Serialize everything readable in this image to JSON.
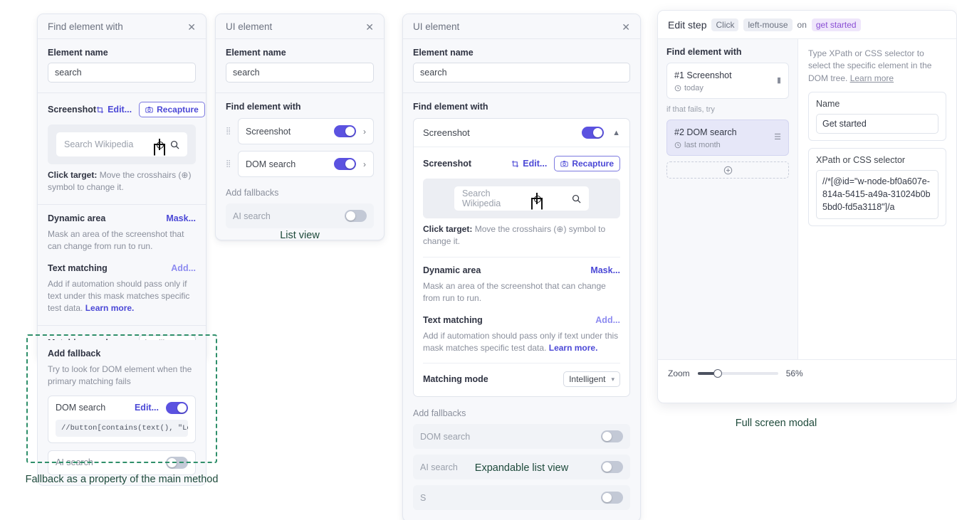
{
  "panel1": {
    "title": "Find element with",
    "close_icon": "close-icon",
    "element_name_label": "Element name",
    "element_name_value": "search",
    "screenshot_label": "Screenshot",
    "edit_label": "Edit...",
    "recapture_label": "Recapture",
    "preview_placeholder": "Search Wikipedia",
    "click_target_bold": "Click target:",
    "click_target_rest": " Move the crosshairs (⊕) symbol to change it.",
    "dynamic_area_label": "Dynamic area",
    "mask_label": "Mask...",
    "dynamic_area_help": "Mask an area of the screenshot that can change from run to run.",
    "text_matching_label": "Text matching",
    "add_label": "Add...",
    "text_matching_help": "Add if automation should pass only if text under this mask matches specific test data. ",
    "learn_more": "Learn more.",
    "matching_mode_label": "Matching mode",
    "matching_mode_value": "Intelligent",
    "fallback_title": "Add fallback",
    "fallback_help": "Try to look for DOM element when the primary matching fails",
    "dom_search_label": "DOM search",
    "dom_edit_label": "Edit...",
    "dom_search_on": true,
    "xpath_code": "//button[contains(text(), \"Login\")]",
    "ai_search_label": "AI search",
    "ai_search_on": false,
    "caption": "Fallback as a property of the main method"
  },
  "panel2": {
    "title": "UI element",
    "element_name_label": "Element name",
    "element_name_value": "search",
    "find_with_label": "Find element with",
    "methods": [
      {
        "label": "Screenshot",
        "on": true
      },
      {
        "label": "DOM search",
        "on": true
      }
    ],
    "add_fallbacks_label": "Add fallbacks",
    "fallbacks": [
      {
        "label": "AI search",
        "on": false
      }
    ],
    "caption": "List view"
  },
  "panel3": {
    "title": "UI element",
    "element_name_label": "Element name",
    "element_name_value": "search",
    "find_with_label": "Find element with",
    "expanded_method": "Screenshot",
    "expanded_on": true,
    "screenshot_label": "Screenshot",
    "edit_label": "Edit...",
    "recapture_label": "Recapture",
    "preview_placeholder": "Search Wikipedia",
    "click_target_bold": "Click target:",
    "click_target_rest": " Move the crosshairs (⊕) symbol to change it.",
    "dynamic_area_label": "Dynamic area",
    "mask_label": "Mask...",
    "dynamic_area_help": "Mask an area of the screenshot that can change from run to run.",
    "text_matching_label": "Text matching",
    "add_label": "Add...",
    "text_matching_help": "Add if automation should pass only if text under this mask matches specific test data. ",
    "learn_more": "Learn more.",
    "matching_mode_label": "Matching mode",
    "matching_mode_value": "Intelligent",
    "add_fallbacks_label": "Add fallbacks",
    "fallbacks": [
      {
        "label": "DOM search",
        "on": false
      },
      {
        "label": "AI search",
        "on": false
      },
      {
        "label": "S",
        "on": false
      }
    ],
    "caption": "Expandable list view"
  },
  "panel4": {
    "head_title": "Edit step",
    "chip_action": "Click",
    "chip_button": "left-mouse",
    "head_on": "on",
    "chip_target": "get started",
    "find_with_label": "Find element with",
    "steps": [
      {
        "title": "#1 Screenshot",
        "time": "today",
        "selected": false
      },
      {
        "title": "#2  DOM search",
        "time": "last month",
        "selected": true
      }
    ],
    "if_fails_label": "if that fails, try",
    "add_step_icon": "plus-circle-icon",
    "hint_text": "Type XPath or CSS selector to select the specific element in the DOM tree. ",
    "hint_link": "Learn more",
    "name_label": "Name",
    "name_value": "Get started",
    "xpath_label": "XPath or CSS selector",
    "xpath_value": "//*[@id=\"w-node-bf0a607e-814a-5415-a49a-31024b0b5bd0-fd5a3118\"]/a",
    "zoom_label": "Zoom",
    "zoom_value": "56%",
    "caption": "Full screen modal"
  },
  "colors": {
    "accent": "#4b48d6",
    "toggle_on": "#5b52e0",
    "toggle_off": "#c3c9d6",
    "caption": "#1e4a3b",
    "dashed": "#2f8f6a",
    "chip_purple_bg": "#efe6fb",
    "chip_purple_fg": "#8a4fd4"
  }
}
